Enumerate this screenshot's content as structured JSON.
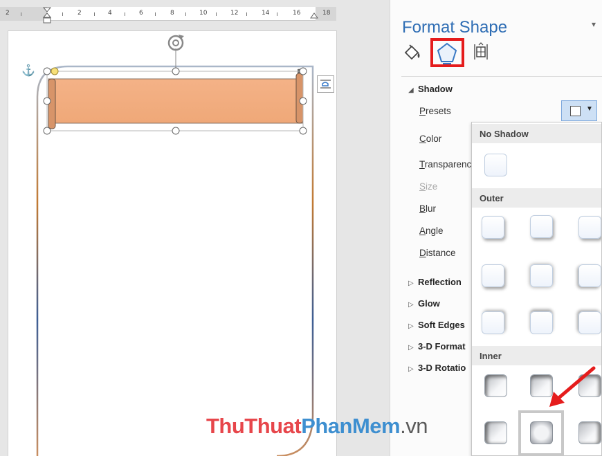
{
  "ruler": {
    "labels": [
      "2",
      "2",
      "4",
      "6",
      "8",
      "10",
      "12",
      "14",
      "16",
      "18"
    ]
  },
  "pane": {
    "title": "Format Shape",
    "menu_glyph": "▾",
    "tabs": [
      {
        "name": "fill-line-icon"
      },
      {
        "name": "effects-icon",
        "selected": true
      },
      {
        "name": "layout-properties-icon"
      }
    ],
    "shadow": {
      "header": "Shadow",
      "expanded": true,
      "properties": [
        {
          "label": "Presets",
          "accel": "P",
          "rest": "resets"
        },
        {
          "label": "Color",
          "accel": "C",
          "rest": "olor"
        },
        {
          "label": "Transparenc",
          "accel": "T",
          "rest": "ransparenc"
        },
        {
          "label": "Size",
          "accel": "S",
          "rest": "ize",
          "disabled": true
        },
        {
          "label": "Blur",
          "accel": "B",
          "rest": "lur"
        },
        {
          "label": "Angle",
          "accel": "A",
          "rest": "ngle"
        },
        {
          "label": "Distance",
          "accel": "D",
          "rest": "istance"
        }
      ]
    },
    "sections": [
      "Reflection",
      "Glow",
      "Soft Edges",
      "3-D Format",
      "3-D Rotatio"
    ]
  },
  "gallery": {
    "groups": [
      {
        "label": "No Shadow",
        "items": 1
      },
      {
        "label": "Outer",
        "items": 9
      },
      {
        "label": "Inner",
        "items": 6
      }
    ],
    "selected": "inner-center"
  },
  "watermark": {
    "part1": "ThuThuat",
    "part2": "PhanMem",
    "part3": ".vn"
  },
  "colors": {
    "accent_blue": "#2e6db4",
    "highlight_red": "#e51c1c",
    "shape_fill": "#f4b287",
    "watermark_red": "#e7464b",
    "watermark_blue": "#3e8fd0"
  }
}
